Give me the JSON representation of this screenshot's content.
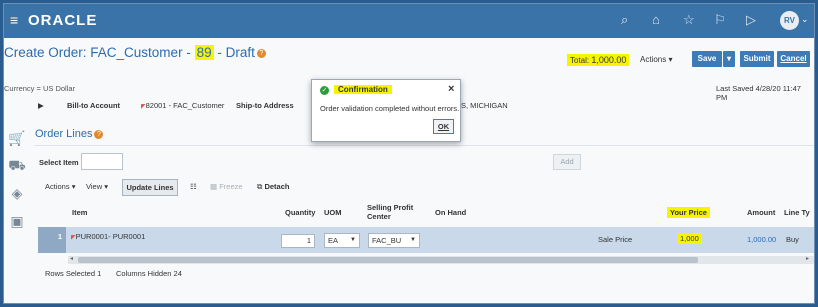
{
  "app": {
    "brand": "ORACLE",
    "avatar_initials": "RV"
  },
  "header": {
    "title_prefix": "Create Order: FAC_Customer - ",
    "order_number": "89",
    "title_suffix": " - Draft",
    "total_label": "Total:",
    "total_value": "1,000.00",
    "actions_label": "Actions",
    "save_label": "Save",
    "submit_label": "Submit",
    "cancel_label": "Cancel"
  },
  "info": {
    "currency": "Currency = US Dollar",
    "last_saved": "Last Saved 4/28/20 11:47 PM",
    "bill_to_label": "Bill-to Account",
    "bill_to_value": "82001 - FAC_Customer",
    "ship_to_label": "Ship-to Address",
    "ship_to_value_partial": "S, MICHIGAN"
  },
  "order_lines": {
    "title": "Order Lines",
    "select_item_label": "Select Item",
    "add_label": "Add",
    "toolbar": {
      "actions": "Actions",
      "view": "View",
      "update_lines": "Update Lines",
      "freeze": "Freeze",
      "detach": "Detach"
    },
    "columns": {
      "item": "Item",
      "quantity": "Quantity",
      "uom": "UOM",
      "selling_profit_center": "Selling Profit Center",
      "on_hand": "On Hand",
      "your_price": "Your Price",
      "amount": "Amount",
      "line_type": "Line Ty"
    },
    "rows": [
      {
        "num": "1",
        "item": "PUR0001- PUR0001",
        "quantity": "1",
        "uom": "EA",
        "profit_center": "FAC_BU",
        "price_label": "Sale Price",
        "your_price": "1,000",
        "amount": "1,000.00",
        "line_type": "Buy"
      }
    ],
    "footer": {
      "rows_selected_label": "Rows Selected",
      "rows_selected_value": "1",
      "columns_hidden_label": "Columns Hidden",
      "columns_hidden_value": "24"
    }
  },
  "dialog": {
    "title": "Confirmation",
    "message": "Order validation completed without errors.",
    "ok_label": "OK"
  }
}
